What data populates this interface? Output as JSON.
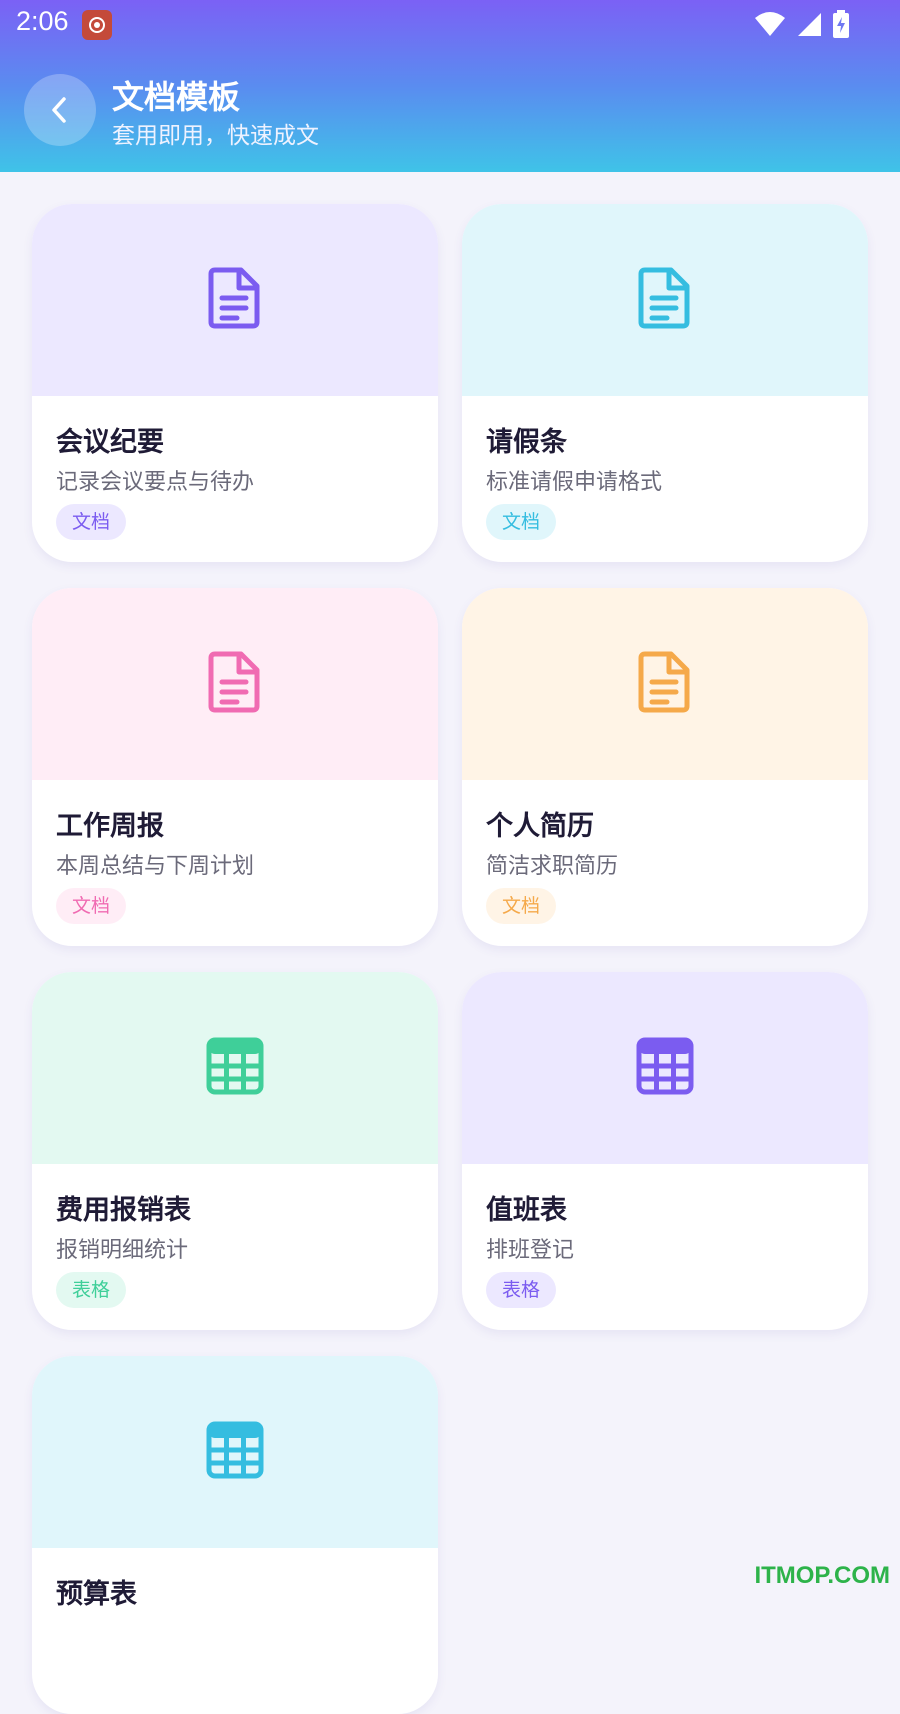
{
  "status_bar": {
    "time": "2:06"
  },
  "header": {
    "title": "文档模板",
    "subtitle": "套用即用，快速成文"
  },
  "templates": [
    {
      "title": "会议纪要",
      "desc": "记录会议要点与待办",
      "tag": "文档",
      "icon": "document-icon",
      "bg": "#ece8ff",
      "accent": "#7b5cf0",
      "tag_bg": "#ece8ff"
    },
    {
      "title": "请假条",
      "desc": "标准请假申请格式",
      "tag": "文档",
      "icon": "document-icon",
      "bg": "#e0f6fb",
      "accent": "#35bde0",
      "tag_bg": "#e0f6fb"
    },
    {
      "title": "工作周报",
      "desc": "本周总结与下周计划",
      "tag": "文档",
      "icon": "document-icon",
      "bg": "#ffedf6",
      "accent": "#f06bb2",
      "tag_bg": "#ffedf6"
    },
    {
      "title": "个人简历",
      "desc": "简洁求职简历",
      "tag": "文档",
      "icon": "document-icon",
      "bg": "#fff4e6",
      "accent": "#f5a94a",
      "tag_bg": "#fff4e6"
    },
    {
      "title": "费用报销表",
      "desc": "报销明细统计",
      "tag": "表格",
      "icon": "table-icon",
      "bg": "#e3f9f1",
      "accent": "#3fcf99",
      "tag_bg": "#e3f9f1"
    },
    {
      "title": "值班表",
      "desc": "排班登记",
      "tag": "表格",
      "icon": "table-icon",
      "bg": "#ece8ff",
      "accent": "#7b5cf0",
      "tag_bg": "#ece8ff"
    },
    {
      "title": "预算表",
      "desc": "",
      "tag": "",
      "icon": "table-icon",
      "bg": "#e0f6fb",
      "accent": "#35bde0",
      "tag_bg": "#e0f6fb"
    }
  ],
  "watermark": "ITMOP.COM"
}
